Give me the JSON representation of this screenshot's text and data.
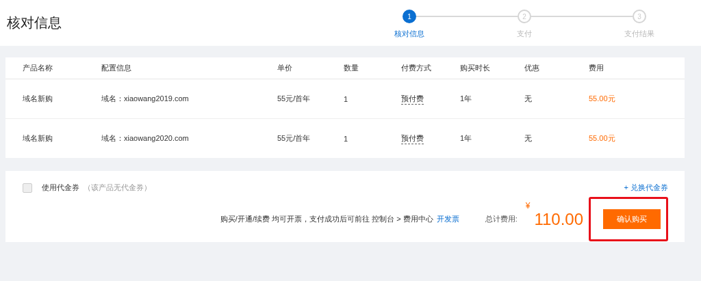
{
  "page_title": "核对信息",
  "steps": [
    {
      "number": "1",
      "label": "核对信息",
      "selected": true
    },
    {
      "number": "2",
      "label": "支付",
      "selected": false
    },
    {
      "number": "3",
      "label": "支付结果",
      "selected": false
    }
  ],
  "table": {
    "columns": [
      "产品名称",
      "配置信息",
      "单价",
      "数量",
      "付费方式",
      "购买时长",
      "优惠",
      "费用"
    ],
    "rows": [
      [
        "域名新购",
        "域名：xiaowang2019.com",
        "55元/首年",
        "1",
        "预付费",
        "1年",
        "无",
        "55.00元"
      ],
      [
        "域名新购",
        "域名：xiaowang2020.com",
        "55元/首年",
        "1",
        "预付费",
        "1年",
        "无",
        "55.00元"
      ]
    ]
  },
  "voucher": {
    "label": "使用代金券",
    "note": "（该产品无代金券）",
    "checked": false,
    "disabled": true,
    "exchange_link": "+ 兑换代金券"
  },
  "invoice_note": "购买/开通/续费 均可开票，支付成功后可前往 控制台 > 费用中心",
  "invoice_link": "开发票",
  "total_label": "总计费用:",
  "currency": "¥",
  "total": "110.00",
  "confirm_button": {
    "label": "确认购买",
    "highlighted": true
  }
}
